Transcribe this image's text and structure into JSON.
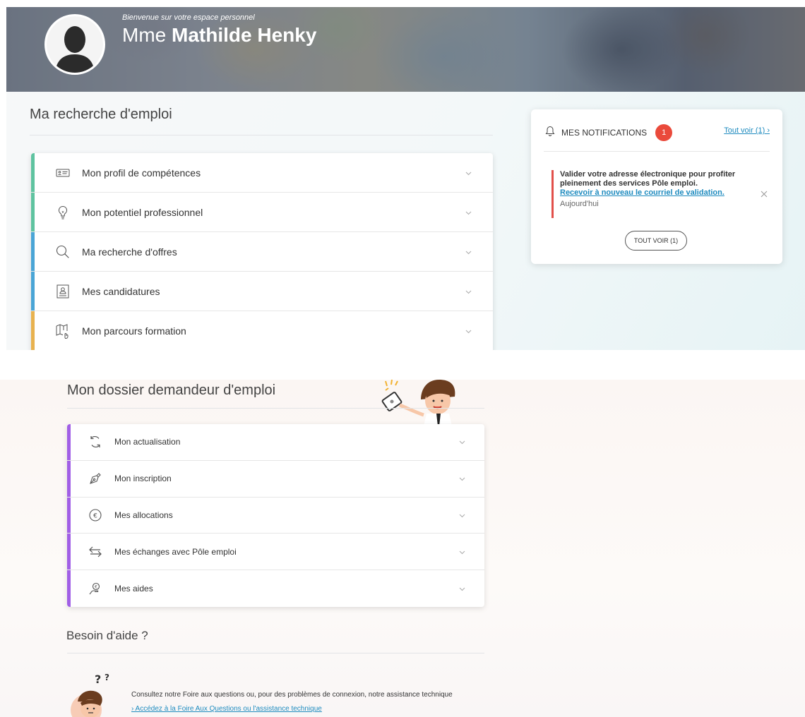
{
  "header": {
    "welcome": "Bienvenue sur votre espace personnel",
    "salutation": "Mme",
    "name": "Mathilde Henky"
  },
  "job_search": {
    "title": "Ma recherche d'emploi",
    "items": [
      {
        "label": "Mon profil de compétences",
        "icon": "id-card-icon",
        "color": "#5fc3a0"
      },
      {
        "label": "Mon potentiel professionnel",
        "icon": "lightbulb-icon",
        "color": "#5fc3a0"
      },
      {
        "label": "Ma recherche d'offres",
        "icon": "search-icon",
        "color": "#4aa5d6"
      },
      {
        "label": "Mes candidatures",
        "icon": "candidate-file-icon",
        "color": "#4aa5d6"
      },
      {
        "label": "Mon parcours formation",
        "icon": "training-path-icon",
        "color": "#e8b24f"
      }
    ]
  },
  "notifications": {
    "title": "MES NOTIFICATIONS",
    "count": "1",
    "see_all_link": "Tout voir (1) ›",
    "item": {
      "text": "Valider votre adresse électronique pour profiter pleinement des services Pôle emploi.",
      "link": "Recevoir à nouveau le courriel de validation.",
      "date": "Aujourd'hui"
    },
    "button": "TOUT VOIR (1)"
  },
  "dossier": {
    "title": "Mon dossier demandeur d'emploi",
    "color": "#a15fe6",
    "items": [
      {
        "label": "Mon actualisation",
        "icon": "refresh-icon"
      },
      {
        "label": "Mon inscription",
        "icon": "pen-nib-icon"
      },
      {
        "label": "Mes allocations",
        "icon": "euro-icon"
      },
      {
        "label": "Mes échanges avec Pôle emploi",
        "icon": "exchange-arrows-icon"
      },
      {
        "label": "Mes aides",
        "icon": "aid-hand-icon"
      }
    ]
  },
  "help": {
    "title": "Besoin d'aide ?",
    "text": "Consultez notre Foire aux questions ou, pour des problèmes de connexion, notre assistance technique",
    "link": "› Accédez à la Foire Aux Questions ou l'assistance technique"
  }
}
